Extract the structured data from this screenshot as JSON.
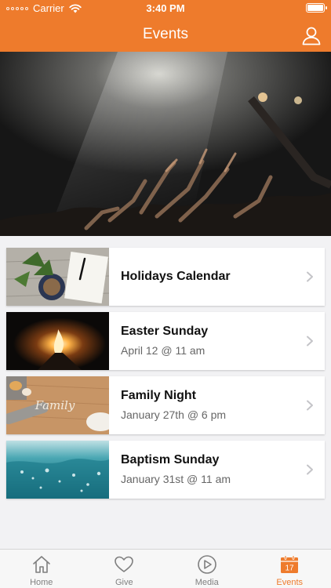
{
  "status_bar": {
    "carrier": "Carrier",
    "time": "3:40 PM"
  },
  "header": {
    "title": "Events"
  },
  "events": [
    {
      "title": "Holidays Calendar",
      "date": ""
    },
    {
      "title": "Easter Sunday",
      "date": "April 12 @ 11 am"
    },
    {
      "title": "Family Night",
      "date": "January 27th @ 6 pm"
    },
    {
      "title": "Baptism Sunday",
      "date": "January 31st @ 11 am"
    }
  ],
  "tabs": [
    {
      "label": "Home",
      "icon": "home-icon"
    },
    {
      "label": "Give",
      "icon": "heart-icon"
    },
    {
      "label": "Media",
      "icon": "play-icon"
    },
    {
      "label": "Events",
      "icon": "calendar-icon",
      "calendar_day": "17",
      "active": true
    }
  ],
  "colors": {
    "accent": "#ee7b2c",
    "background": "#f2f2f4",
    "inactive_tab": "#7f7f7f"
  }
}
